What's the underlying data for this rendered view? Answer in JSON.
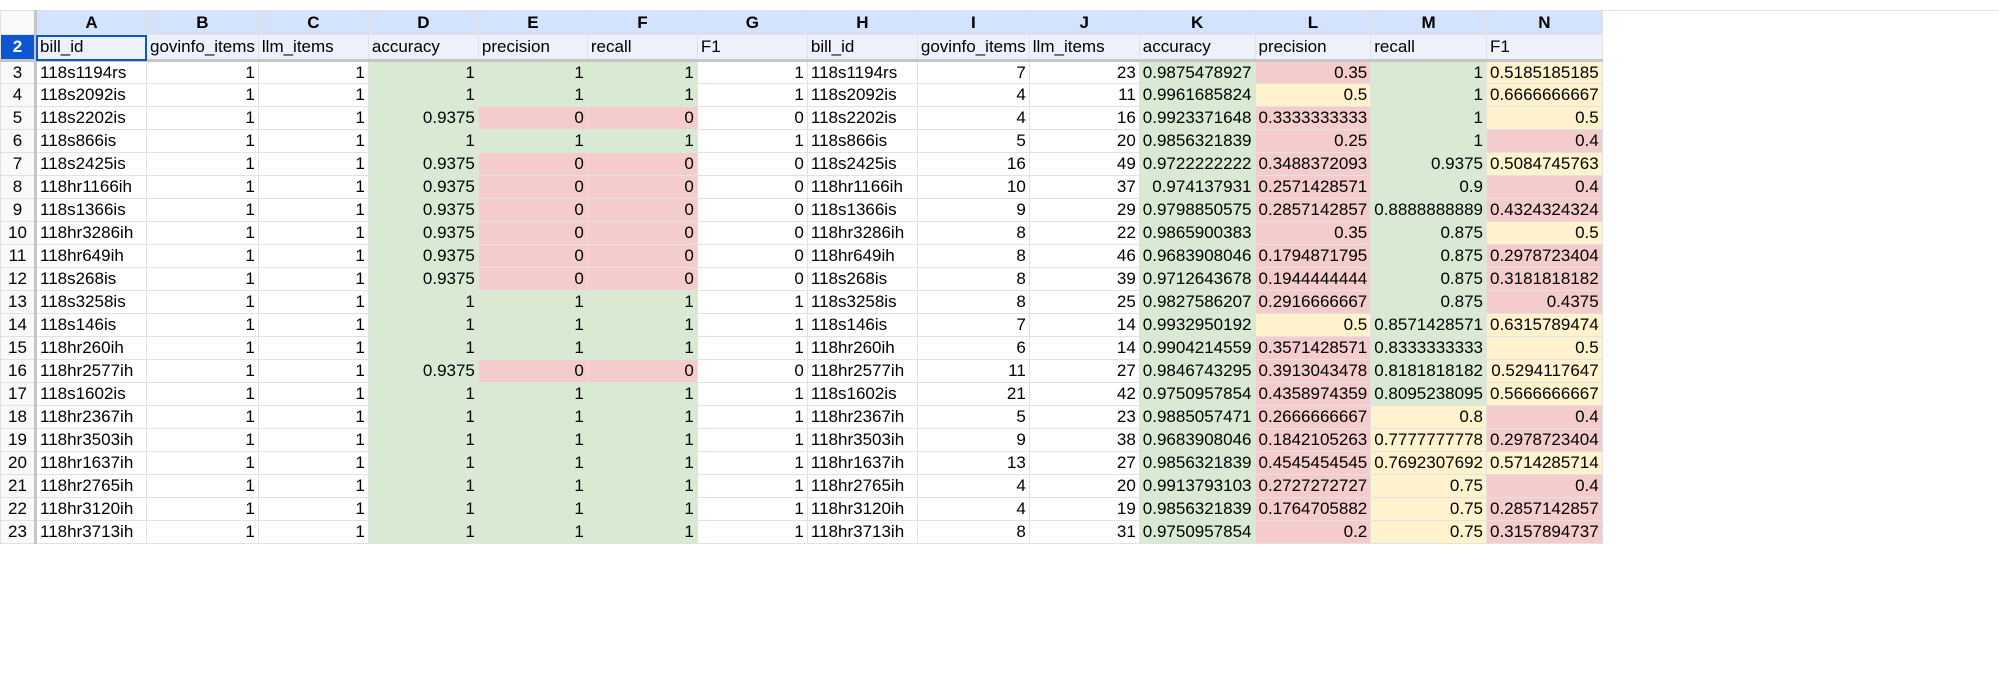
{
  "columns": [
    "A",
    "B",
    "C",
    "D",
    "E",
    "F",
    "G",
    "H",
    "I",
    "J",
    "K",
    "L",
    "M",
    "N"
  ],
  "header_row": {
    "num": "2",
    "cells": [
      "bill_id",
      "govinfo_items",
      "llm_items",
      "accuracy",
      "precision",
      "recall",
      "F1",
      "bill_id",
      "govinfo_items",
      "llm_items",
      "accuracy",
      "precision",
      "recall",
      "F1"
    ]
  },
  "fill_colors": {
    "green": "#d9ead3",
    "red": "#f4cccc",
    "yellow": "#fff2cc",
    "selection": "#0b57d0",
    "column_header": "#d3e3fd"
  },
  "rows": [
    {
      "num": "3",
      "cells": [
        "118s1194rs",
        "1",
        "1",
        "1",
        "1",
        "1",
        "1",
        "118s1194rs",
        "7",
        "23",
        "0.9875478927",
        "0.35",
        "1",
        "0.5185185185"
      ],
      "fills": [
        "",
        "",
        "",
        "g",
        "g",
        "g",
        "",
        "",
        "",
        "",
        "g",
        "r",
        "g",
        "y"
      ]
    },
    {
      "num": "4",
      "cells": [
        "118s2092is",
        "1",
        "1",
        "1",
        "1",
        "1",
        "1",
        "118s2092is",
        "4",
        "11",
        "0.9961685824",
        "0.5",
        "1",
        "0.6666666667"
      ],
      "fills": [
        "",
        "",
        "",
        "g",
        "g",
        "g",
        "",
        "",
        "",
        "",
        "g",
        "y",
        "g",
        "y"
      ]
    },
    {
      "num": "5",
      "cells": [
        "118s2202is",
        "1",
        "1",
        "0.9375",
        "0",
        "0",
        "0",
        "118s2202is",
        "4",
        "16",
        "0.9923371648",
        "0.3333333333",
        "1",
        "0.5"
      ],
      "fills": [
        "",
        "",
        "",
        "g",
        "r",
        "r",
        "",
        "",
        "",
        "",
        "g",
        "r",
        "g",
        "y"
      ]
    },
    {
      "num": "6",
      "cells": [
        "118s866is",
        "1",
        "1",
        "1",
        "1",
        "1",
        "1",
        "118s866is",
        "5",
        "20",
        "0.9856321839",
        "0.25",
        "1",
        "0.4"
      ],
      "fills": [
        "",
        "",
        "",
        "g",
        "g",
        "g",
        "",
        "",
        "",
        "",
        "g",
        "r",
        "g",
        "r"
      ]
    },
    {
      "num": "7",
      "cells": [
        "118s2425is",
        "1",
        "1",
        "0.9375",
        "0",
        "0",
        "0",
        "118s2425is",
        "16",
        "49",
        "0.9722222222",
        "0.3488372093",
        "0.9375",
        "0.5084745763"
      ],
      "fills": [
        "",
        "",
        "",
        "g",
        "r",
        "r",
        "",
        "",
        "",
        "",
        "g",
        "r",
        "g",
        "y"
      ]
    },
    {
      "num": "8",
      "cells": [
        "118hr1166ih",
        "1",
        "1",
        "0.9375",
        "0",
        "0",
        "0",
        "118hr1166ih",
        "10",
        "37",
        "0.974137931",
        "0.2571428571",
        "0.9",
        "0.4"
      ],
      "fills": [
        "",
        "",
        "",
        "g",
        "r",
        "r",
        "",
        "",
        "",
        "",
        "g",
        "r",
        "g",
        "r"
      ]
    },
    {
      "num": "9",
      "cells": [
        "118s1366is",
        "1",
        "1",
        "0.9375",
        "0",
        "0",
        "0",
        "118s1366is",
        "9",
        "29",
        "0.9798850575",
        "0.2857142857",
        "0.8888888889",
        "0.4324324324"
      ],
      "fills": [
        "",
        "",
        "",
        "g",
        "r",
        "r",
        "",
        "",
        "",
        "",
        "g",
        "r",
        "g",
        "r"
      ]
    },
    {
      "num": "10",
      "cells": [
        "118hr3286ih",
        "1",
        "1",
        "0.9375",
        "0",
        "0",
        "0",
        "118hr3286ih",
        "8",
        "22",
        "0.9865900383",
        "0.35",
        "0.875",
        "0.5"
      ],
      "fills": [
        "",
        "",
        "",
        "g",
        "r",
        "r",
        "",
        "",
        "",
        "",
        "g",
        "r",
        "g",
        "y"
      ]
    },
    {
      "num": "11",
      "cells": [
        "118hr649ih",
        "1",
        "1",
        "0.9375",
        "0",
        "0",
        "0",
        "118hr649ih",
        "8",
        "46",
        "0.9683908046",
        "0.1794871795",
        "0.875",
        "0.2978723404"
      ],
      "fills": [
        "",
        "",
        "",
        "g",
        "r",
        "r",
        "",
        "",
        "",
        "",
        "g",
        "r",
        "g",
        "r"
      ]
    },
    {
      "num": "12",
      "cells": [
        "118s268is",
        "1",
        "1",
        "0.9375",
        "0",
        "0",
        "0",
        "118s268is",
        "8",
        "39",
        "0.9712643678",
        "0.1944444444",
        "0.875",
        "0.3181818182"
      ],
      "fills": [
        "",
        "",
        "",
        "g",
        "r",
        "r",
        "",
        "",
        "",
        "",
        "g",
        "r",
        "g",
        "r"
      ]
    },
    {
      "num": "13",
      "cells": [
        "118s3258is",
        "1",
        "1",
        "1",
        "1",
        "1",
        "1",
        "118s3258is",
        "8",
        "25",
        "0.9827586207",
        "0.2916666667",
        "0.875",
        "0.4375"
      ],
      "fills": [
        "",
        "",
        "",
        "g",
        "g",
        "g",
        "",
        "",
        "",
        "",
        "g",
        "r",
        "g",
        "r"
      ]
    },
    {
      "num": "14",
      "cells": [
        "118s146is",
        "1",
        "1",
        "1",
        "1",
        "1",
        "1",
        "118s146is",
        "7",
        "14",
        "0.9932950192",
        "0.5",
        "0.8571428571",
        "0.6315789474"
      ],
      "fills": [
        "",
        "",
        "",
        "g",
        "g",
        "g",
        "",
        "",
        "",
        "",
        "g",
        "y",
        "g",
        "y"
      ]
    },
    {
      "num": "15",
      "cells": [
        "118hr260ih",
        "1",
        "1",
        "1",
        "1",
        "1",
        "1",
        "118hr260ih",
        "6",
        "14",
        "0.9904214559",
        "0.3571428571",
        "0.8333333333",
        "0.5"
      ],
      "fills": [
        "",
        "",
        "",
        "g",
        "g",
        "g",
        "",
        "",
        "",
        "",
        "g",
        "r",
        "g",
        "y"
      ]
    },
    {
      "num": "16",
      "cells": [
        "118hr2577ih",
        "1",
        "1",
        "0.9375",
        "0",
        "0",
        "0",
        "118hr2577ih",
        "11",
        "27",
        "0.9846743295",
        "0.3913043478",
        "0.8181818182",
        "0.5294117647"
      ],
      "fills": [
        "",
        "",
        "",
        "g",
        "r",
        "r",
        "",
        "",
        "",
        "",
        "g",
        "r",
        "g",
        "y"
      ]
    },
    {
      "num": "17",
      "cells": [
        "118s1602is",
        "1",
        "1",
        "1",
        "1",
        "1",
        "1",
        "118s1602is",
        "21",
        "42",
        "0.9750957854",
        "0.4358974359",
        "0.8095238095",
        "0.5666666667"
      ],
      "fills": [
        "",
        "",
        "",
        "g",
        "g",
        "g",
        "",
        "",
        "",
        "",
        "g",
        "r",
        "g",
        "y"
      ]
    },
    {
      "num": "18",
      "cells": [
        "118hr2367ih",
        "1",
        "1",
        "1",
        "1",
        "1",
        "1",
        "118hr2367ih",
        "5",
        "23",
        "0.9885057471",
        "0.2666666667",
        "0.8",
        "0.4"
      ],
      "fills": [
        "",
        "",
        "",
        "g",
        "g",
        "g",
        "",
        "",
        "",
        "",
        "g",
        "r",
        "y",
        "r"
      ]
    },
    {
      "num": "19",
      "cells": [
        "118hr3503ih",
        "1",
        "1",
        "1",
        "1",
        "1",
        "1",
        "118hr3503ih",
        "9",
        "38",
        "0.9683908046",
        "0.1842105263",
        "0.7777777778",
        "0.2978723404"
      ],
      "fills": [
        "",
        "",
        "",
        "g",
        "g",
        "g",
        "",
        "",
        "",
        "",
        "g",
        "r",
        "y",
        "r"
      ]
    },
    {
      "num": "20",
      "cells": [
        "118hr1637ih",
        "1",
        "1",
        "1",
        "1",
        "1",
        "1",
        "118hr1637ih",
        "13",
        "27",
        "0.9856321839",
        "0.4545454545",
        "0.7692307692",
        "0.5714285714"
      ],
      "fills": [
        "",
        "",
        "",
        "g",
        "g",
        "g",
        "",
        "",
        "",
        "",
        "g",
        "r",
        "y",
        "y"
      ]
    },
    {
      "num": "21",
      "cells": [
        "118hr2765ih",
        "1",
        "1",
        "1",
        "1",
        "1",
        "1",
        "118hr2765ih",
        "4",
        "20",
        "0.9913793103",
        "0.2727272727",
        "0.75",
        "0.4"
      ],
      "fills": [
        "",
        "",
        "",
        "g",
        "g",
        "g",
        "",
        "",
        "",
        "",
        "g",
        "r",
        "y",
        "r"
      ]
    },
    {
      "num": "22",
      "cells": [
        "118hr3120ih",
        "1",
        "1",
        "1",
        "1",
        "1",
        "1",
        "118hr3120ih",
        "4",
        "19",
        "0.9856321839",
        "0.1764705882",
        "0.75",
        "0.2857142857"
      ],
      "fills": [
        "",
        "",
        "",
        "g",
        "g",
        "g",
        "",
        "",
        "",
        "",
        "g",
        "r",
        "y",
        "r"
      ]
    },
    {
      "num": "23",
      "cells": [
        "118hr3713ih",
        "1",
        "1",
        "1",
        "1",
        "1",
        "1",
        "118hr3713ih",
        "8",
        "31",
        "0.9750957854",
        "0.2",
        "0.75",
        "0.3157894737"
      ],
      "fills": [
        "",
        "",
        "",
        "g",
        "g",
        "g",
        "",
        "",
        "",
        "",
        "g",
        "r",
        "y",
        "r"
      ]
    }
  ]
}
